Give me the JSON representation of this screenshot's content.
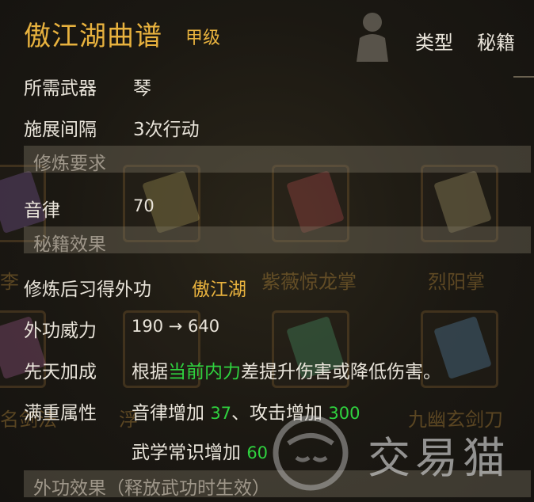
{
  "item": {
    "title": "傲江湖曲谱",
    "grade": "甲级",
    "type_label": "类型",
    "type_value": "秘籍"
  },
  "stats": [
    {
      "label": "所需武器",
      "value": "琴"
    },
    {
      "label": "施展间隔",
      "value": "3次行动"
    }
  ],
  "requirements": {
    "header": "修炼要求",
    "rows": [
      {
        "label": "音律",
        "value": "70"
      }
    ]
  },
  "effects": {
    "header": "秘籍效果",
    "learn_label": "修炼后习得外功",
    "learn_value": "傲江湖",
    "power_label": "外功威力",
    "power_value": "190 → 640",
    "innate_label": "先天加成",
    "innate_prefix": "根据",
    "innate_highlight": "当前内力",
    "innate_suffix": "差提升伤害或降低伤害。",
    "full_label": "满重属性",
    "full_line1_a": "音律增加",
    "full_line1_a_val": "37",
    "full_line1_sep": "、",
    "full_line1_b": "攻击增加",
    "full_line1_b_val": "300",
    "full_line2": "武学常识增加",
    "full_line2_val": "60"
  },
  "external": {
    "header": "外功效果（释放武功时生效）"
  },
  "background_labels": [
    "李",
    "紫薇惊龙掌",
    "烈阳掌",
    "名剑法",
    "浮",
    "九幽玄剑刀"
  ],
  "watermark": {
    "text": "交易猫"
  },
  "colors": {
    "gold": "#e8b23e",
    "green": "#2fd23f",
    "text": "#e9e4da",
    "section_text": "#9f978a"
  }
}
